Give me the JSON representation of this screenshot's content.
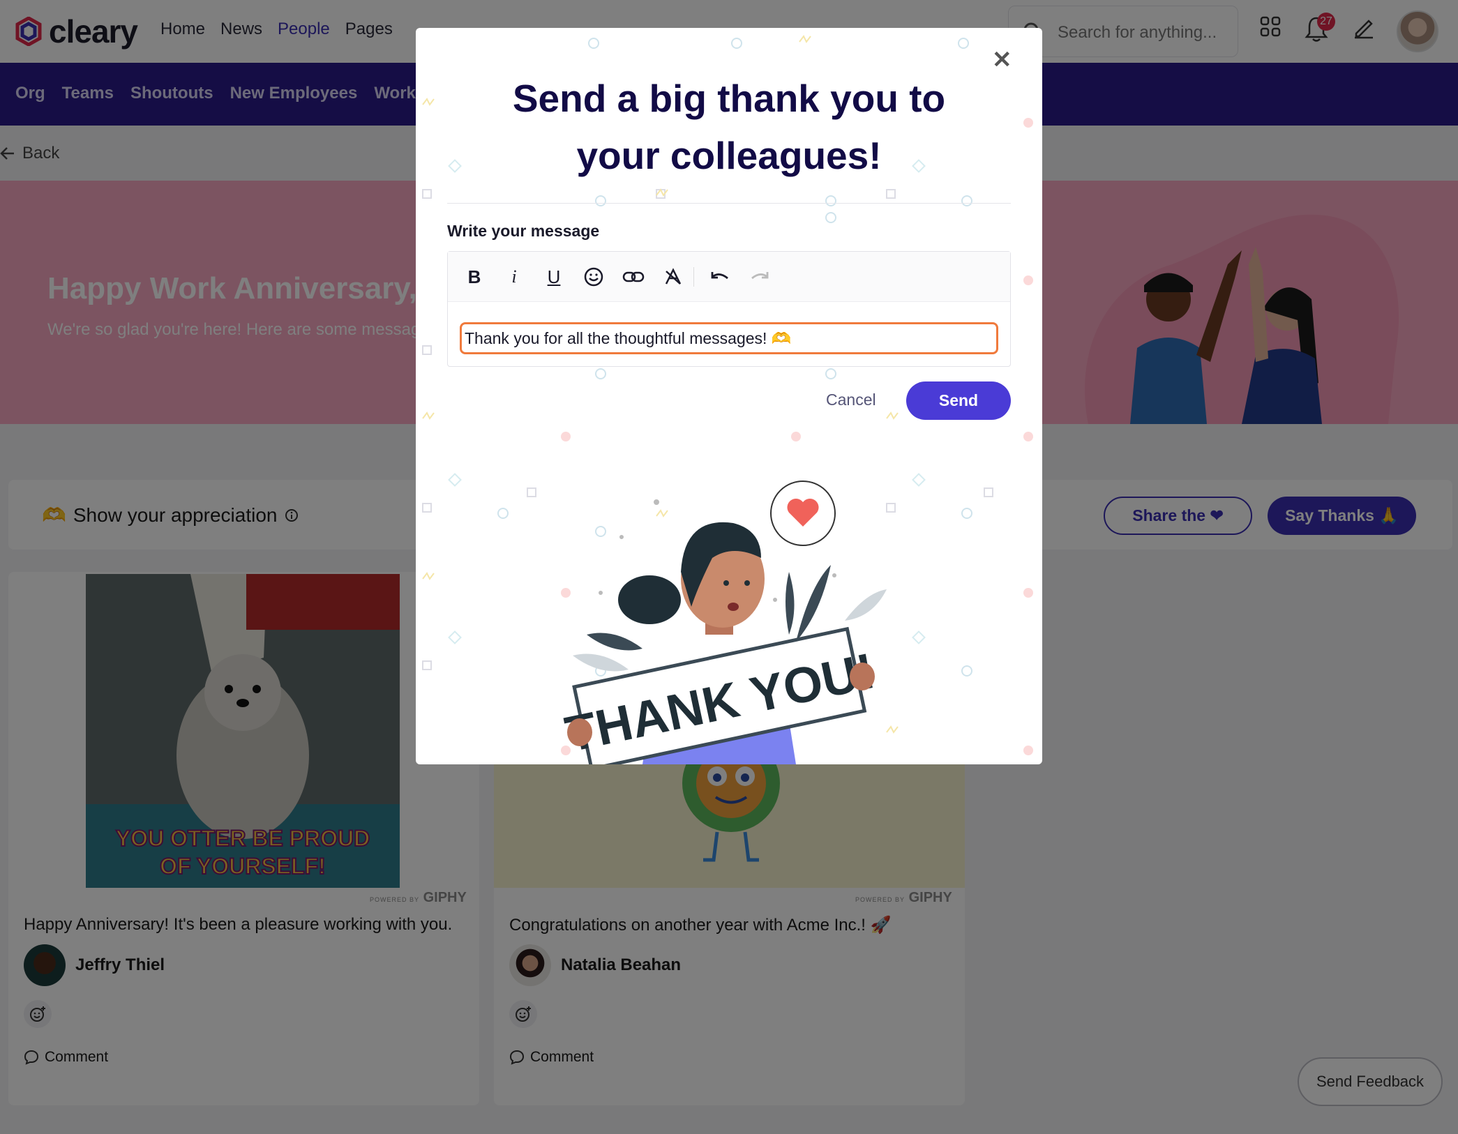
{
  "app": {
    "logo_text": "cleary",
    "nav": [
      "Home",
      "News",
      "People",
      "Pages"
    ],
    "nav_active": "People",
    "search_placeholder": "Search for anything...",
    "notifications_count": "27"
  },
  "subnav": [
    "Org",
    "Teams",
    "Shoutouts",
    "New Employees",
    "Work An"
  ],
  "back_label": "Back",
  "banner": {
    "title": "Happy Work Anniversary,",
    "subtitle": "We're so glad you're here! Here are some messag"
  },
  "appreciation": {
    "title": "Show your appreciation",
    "share_label": "Share the",
    "say_thanks_label": "Say Thanks"
  },
  "cards": [
    {
      "gif_caption_line1": "YOU OTTER BE PROUD",
      "gif_caption_line2": "OF YOURSELF!",
      "message": "Happy Anniversary! It's been a pleasure working with you.",
      "author": "Jeffry Thiel",
      "comment_label": "Comment"
    },
    {
      "message": "Congratulations on another year with Acme Inc.! 🚀",
      "author": "Natalia Beahan",
      "comment_label": "Comment"
    }
  ],
  "giphy": {
    "powered_by": "POWERED BY",
    "brand": "GIPHY"
  },
  "feedback_label": "Send Feedback",
  "modal": {
    "title_line1": "Send a big thank you to",
    "title_line2": "your colleagues!",
    "message_label": "Write your message",
    "message_value": "Thank you for all the thoughtful messages! 🫶",
    "cancel_label": "Cancel",
    "send_label": "Send",
    "illustration_text": "THANK YOU!"
  },
  "colors": {
    "brand_purple": "#3b2fb2",
    "subnav_bg": "#2a1a8a",
    "banner_pink": "#f8a9c2",
    "send_button": "#4a3bd6",
    "input_focus": "#f07a3c"
  }
}
